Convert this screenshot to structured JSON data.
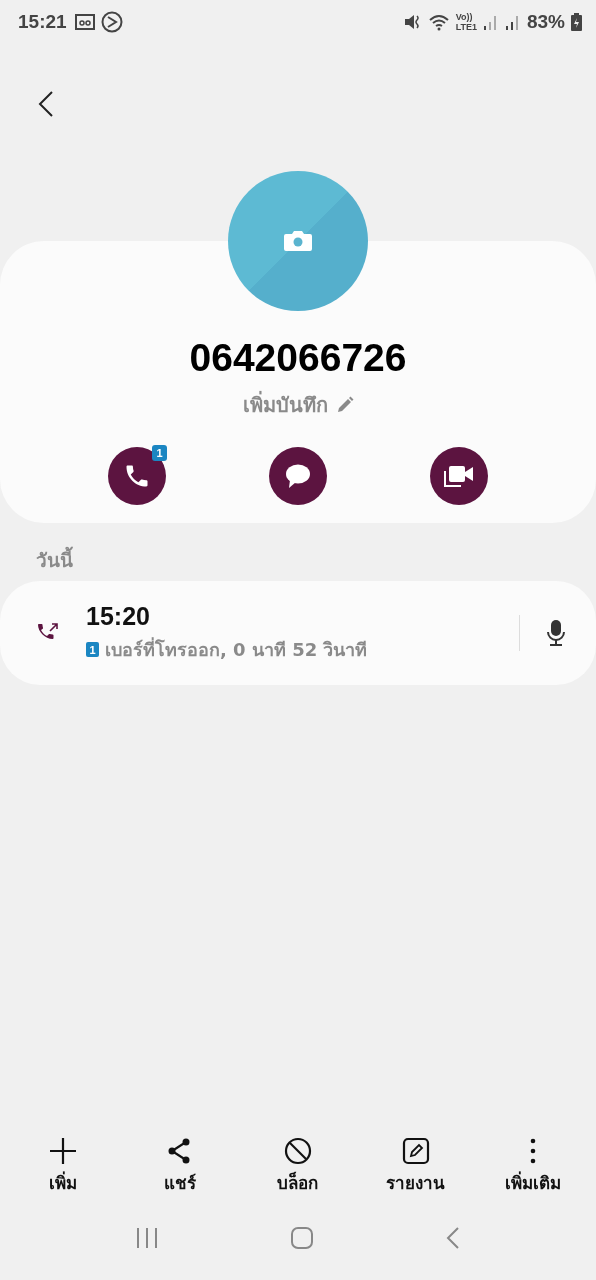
{
  "status_bar": {
    "time": "15:21",
    "volte": "Vo))",
    "network": "LTE1",
    "battery": "83%"
  },
  "contact": {
    "number": "0642066726",
    "note": "เพิ่มบันทึก"
  },
  "actions": [
    {
      "kind": "call",
      "badge": "1"
    },
    {
      "kind": "message"
    },
    {
      "kind": "video"
    }
  ],
  "section": "วันนี้",
  "calls": [
    {
      "time": "15:20",
      "sim": "1",
      "detail": "เบอร์ที่โทรออก, 0 นาที 52 วินาที"
    }
  ],
  "toolbar": [
    {
      "kind": "add",
      "label": "เพิ่ม"
    },
    {
      "kind": "share",
      "label": "แชร์"
    },
    {
      "kind": "block",
      "label": "บล็อก"
    },
    {
      "kind": "report",
      "label": "รายงาน"
    },
    {
      "kind": "more",
      "label": "เพิ่มเติม"
    }
  ]
}
